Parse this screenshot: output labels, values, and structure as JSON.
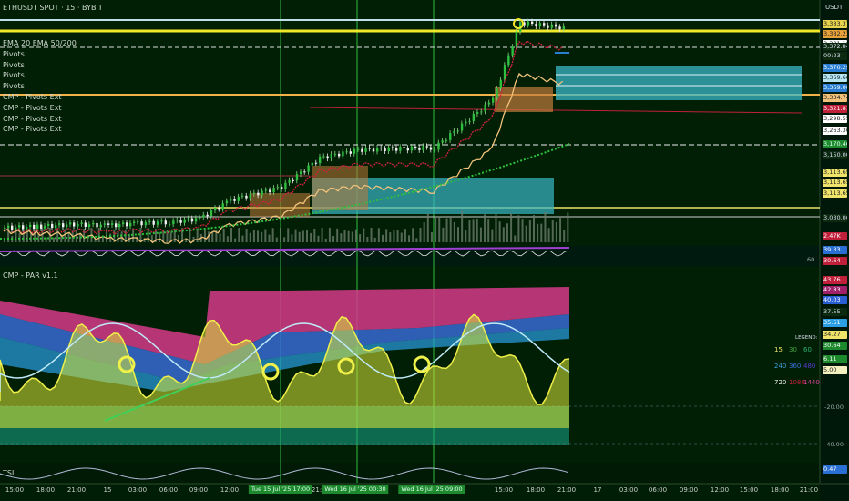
{
  "header": {
    "symbol_line": "ETHUSDT SPOT · 15 · BYBIT",
    "quote": "USDT"
  },
  "indicators": [
    "EMA 20 EMA 50/200",
    "Pivots",
    "Pivots",
    "Pivots",
    "Pivots",
    "CMP - Pivots Ext",
    "CMP - Pivots Ext",
    "CMP - Pivots Ext",
    "CMP - Pivots Ext"
  ],
  "price_labels": [
    {
      "text": "3,383.37",
      "bg": "#e8d44d",
      "fg": "#222"
    },
    {
      "text": "3,382.23",
      "bg": "#e8a23a",
      "fg": "#222"
    },
    {
      "text": "3,381.18",
      "bg": "#ffffff",
      "fg": "#222"
    },
    {
      "text": "3,372.84",
      "bg": "#0b2a10",
      "fg": "#dde"
    },
    {
      "text": "00:23",
      "bg": "#0b2a10",
      "fg": "#dde"
    },
    {
      "text": "3,370.29",
      "bg": "#2a7fd4",
      "fg": "#fff"
    },
    {
      "text": "3,369.66",
      "bg": "#b8e6f0",
      "fg": "#123"
    },
    {
      "text": "3,369.00",
      "bg": "#2a7fd4",
      "fg": "#fff"
    },
    {
      "text": "3,334.74",
      "bg": "#f2c27a",
      "fg": "#222"
    },
    {
      "text": "3,321.81",
      "bg": "#c1203a",
      "fg": "#fff"
    },
    {
      "text": "3,298.55",
      "bg": "#ffffff",
      "fg": "#222"
    },
    {
      "text": "3,263.36",
      "bg": "#ffffff",
      "fg": "#222"
    },
    {
      "text": "3,170.46",
      "bg": "#1e8a2e",
      "fg": "#dfe"
    },
    {
      "text": "3,150.00",
      "bg": "#0b2a10",
      "fg": "#dde"
    },
    {
      "text": "3,113.65",
      "bg": "#f0e36a",
      "fg": "#222"
    },
    {
      "text": "3,113.65",
      "bg": "#f0e36a",
      "fg": "#222"
    },
    {
      "text": "3,113.65",
      "bg": "#f0e36a",
      "fg": "#222"
    },
    {
      "text": "3,030.00",
      "bg": "#0b2a10",
      "fg": "#dde"
    },
    {
      "text": "2.47K",
      "bg": "#c1203a",
      "fg": "#fff"
    },
    {
      "text": "39.33",
      "bg": "#2a6fd4",
      "fg": "#fff"
    },
    {
      "text": "30.64",
      "bg": "#c1203a",
      "fg": "#fff"
    }
  ],
  "osc_title": "CMP - PAR v1.1",
  "osc_labels": [
    {
      "text": "43.76",
      "bg": "#c1203a",
      "fg": "#fff"
    },
    {
      "text": "42.83",
      "bg": "#a0206a",
      "fg": "#fff"
    },
    {
      "text": "40.03",
      "bg": "#2a5fd4",
      "fg": "#fff"
    },
    {
      "text": "37.55",
      "bg": "#0b2a10",
      "fg": "#dde"
    },
    {
      "text": "35.51",
      "bg": "#2a9fe4",
      "fg": "#fff"
    },
    {
      "text": "34.27",
      "bg": "#f0e36a",
      "fg": "#222"
    },
    {
      "text": "30.64",
      "bg": "#1e8a2e",
      "fg": "#fff"
    },
    {
      "text": "6.11",
      "bg": "#1e8a2e",
      "fg": "#fff"
    },
    {
      "text": "5.00",
      "bg": "#f5f0c0",
      "fg": "#222"
    }
  ],
  "osc_axis": [
    "-20.00",
    "-40.00"
  ],
  "legend": {
    "title": "LEGEND:",
    "rows": [
      [
        {
          "t": "15",
          "c": "#f0e36a"
        },
        {
          "t": "30",
          "c": "#3fa03f"
        },
        {
          "t": "60",
          "c": "#2ab07a"
        }
      ],
      [
        {
          "t": "240",
          "c": "#3fa0e0"
        },
        {
          "t": "360",
          "c": "#3a6fe0"
        },
        {
          "t": "480",
          "c": "#5a3ad0"
        }
      ],
      [
        {
          "t": "720",
          "c": "#f0f0f0"
        },
        {
          "t": "1080",
          "c": "#c1203a"
        },
        {
          "t": "1440",
          "c": "#e040a0"
        }
      ]
    ]
  },
  "tsi": {
    "label": "TSI",
    "value": "0.47"
  },
  "misc": {
    "osc_side_value": "60"
  },
  "time_axis": [
    {
      "t": "15:00",
      "x": 16
    },
    {
      "t": "18:00",
      "x": 50
    },
    {
      "t": "21:00",
      "x": 84
    },
    {
      "t": "15",
      "x": 118
    },
    {
      "t": "03:00",
      "x": 151
    },
    {
      "t": "06:00",
      "x": 185
    },
    {
      "t": "09:00",
      "x": 218
    },
    {
      "t": "12:00",
      "x": 252
    },
    {
      "t": "Tue 15 Jul '25 17:00",
      "x": 308,
      "hl": true
    },
    {
      "t": "21:00",
      "x": 352
    },
    {
      "t": "Wed 16 Jul '25 00:30",
      "x": 390,
      "hl": true
    },
    {
      "t": "Wed 16 Jul '25 09:00",
      "x": 474,
      "hl": true
    },
    {
      "t": "15:00",
      "x": 553
    },
    {
      "t": "18:00",
      "x": 588
    },
    {
      "t": "21:00",
      "x": 622
    },
    {
      "t": "17",
      "x": 656
    },
    {
      "t": "03:00",
      "x": 690
    },
    {
      "t": "06:00",
      "x": 722
    },
    {
      "t": "09:00",
      "x": 756
    },
    {
      "t": "12:00",
      "x": 790
    },
    {
      "t": "15:00",
      "x": 822
    },
    {
      "t": "18:00",
      "x": 856
    },
    {
      "t": "21:00",
      "x": 888
    }
  ],
  "chart_data": {
    "type": "line",
    "title": "ETHUSDT SPOT · 15 · BYBIT",
    "xlabel": "",
    "ylabel": "",
    "ylim": [
      3030,
      3384
    ],
    "x": [
      "15:00",
      "18:00",
      "21:00",
      "15",
      "03:00",
      "06:00",
      "09:00",
      "12:00",
      "17:00",
      "21:00",
      "00:30",
      "09:00",
      "15:00",
      "18:00",
      "21:00"
    ],
    "series": [
      {
        "name": "",
        "values": [
          3030,
          3032,
          3036,
          3034,
          3038,
          3040,
          3046,
          3078,
          3100,
          3150,
          3164,
          3168,
          3250,
          3383,
          3373
        ]
      }
    ]
  }
}
